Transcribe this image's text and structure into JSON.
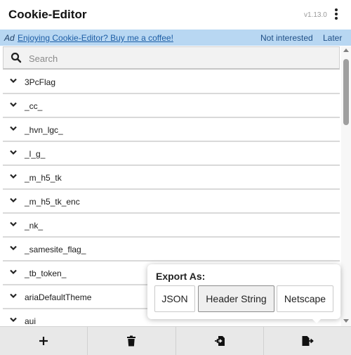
{
  "header": {
    "title": "Cookie-Editor",
    "version": "v1.13.0",
    "menu_icon": "kebab-menu-icon"
  },
  "ad": {
    "label": "Ad",
    "link_text": "Enjoying Cookie-Editor? Buy me a coffee!",
    "not_interested": "Not interested",
    "later": "Later",
    "background": "#b8d7f2"
  },
  "search": {
    "placeholder": "Search",
    "value": "",
    "icon": "search-icon"
  },
  "cookies": [
    {
      "name": "3PcFlag"
    },
    {
      "name": "_cc_"
    },
    {
      "name": "_hvn_lgc_"
    },
    {
      "name": "_l_g_"
    },
    {
      "name": "_m_h5_tk"
    },
    {
      "name": "_m_h5_tk_enc"
    },
    {
      "name": "_nk_"
    },
    {
      "name": "_samesite_flag_"
    },
    {
      "name": "_tb_token_"
    },
    {
      "name": "ariaDefaultTheme"
    },
    {
      "name": "aui"
    }
  ],
  "footer": {
    "buttons": [
      {
        "icon": "plus-icon",
        "action": "add"
      },
      {
        "icon": "trash-icon",
        "action": "delete-all"
      },
      {
        "icon": "import-icon",
        "action": "import"
      },
      {
        "icon": "export-icon",
        "action": "export"
      }
    ]
  },
  "export_popover": {
    "title": "Export As:",
    "options": [
      "JSON",
      "Header String",
      "Netscape"
    ],
    "selected": "Header String"
  }
}
